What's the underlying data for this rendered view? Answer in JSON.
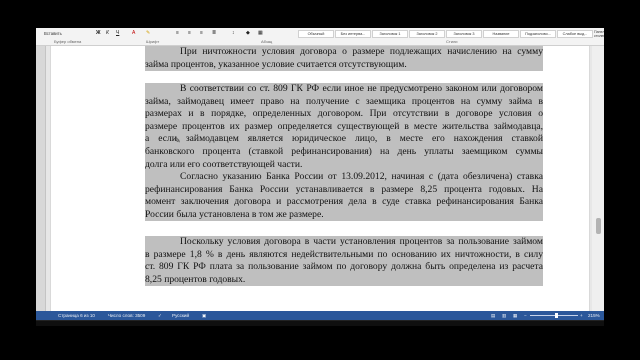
{
  "ribbon": {
    "paste_label": "Вставить",
    "clipboard_label": "Буфер обмена",
    "font_group": "Шрифт",
    "paragraph_group": "Абзац",
    "styles_group": "Стили",
    "bold": "Ж",
    "italic": "К",
    "underline": "Ч",
    "styles": [
      "Обычный",
      "Без интерва...",
      "Заголовок 1",
      "Заголовок 2",
      "Заголовок 3",
      "Название",
      "Подзаголово...",
      "Слабое выд..."
    ],
    "styles_pane": "Панель стилей"
  },
  "document": {
    "paragraphs": [
      {
        "lines": [
          "При ничтожности условия договора о размере подлежащих начислению на сумму",
          "займа процентов, указанное условие считается отсутствующим."
        ]
      },
      {
        "lines": [
          "В соответствии со ст. 809 ГК РФ если иное не предусмотрено законом или договором",
          "займа, займодавец имеет право на получение с заемщика процентов на сумму займа в",
          "размерах и в порядке, определенных договором. При отсутствии в договоре условия о",
          "размере процентов их размер определяется существующей в месте жительства займодавца,",
          "а если займодавцем является юридическое лицо, в месте его нахождения ставкой",
          "банковского процента (ставкой рефинансирования) на день уплаты заемщиком суммы",
          "долга или его соответствующей части."
        ]
      },
      {
        "lines": [
          "Согласно указанию Банка России от 13.09.2012, начиная с (дата обезличена) ставка",
          "рефинансирования Банка России устанавливается в размере 8,25 процента годовых. На",
          "момент заключения договора и рассмотрения дела в суде ставка рефинансирования Банка",
          "России была установлена в том же размере."
        ]
      },
      {
        "lines": [
          "Поскольку условия договора в части установления процентов за пользование займом",
          "в размере 1,8 % в день являются недействительными по основанию их ничтожности, в силу",
          "ст. 809 ГК РФ плата за пользование займом по договору должна быть определена из расчета",
          "8,25 процентов годовых."
        ]
      }
    ]
  },
  "status": {
    "page": "Страница 6 из 10",
    "words": "Число слов: 3509",
    "language": "Русский",
    "zoom": "215%",
    "zoom_level": 0.55
  },
  "colors": {
    "highlight": "#bfbfbf",
    "statusbar": "#2b579a",
    "ribbon": "#f3f3f3"
  }
}
